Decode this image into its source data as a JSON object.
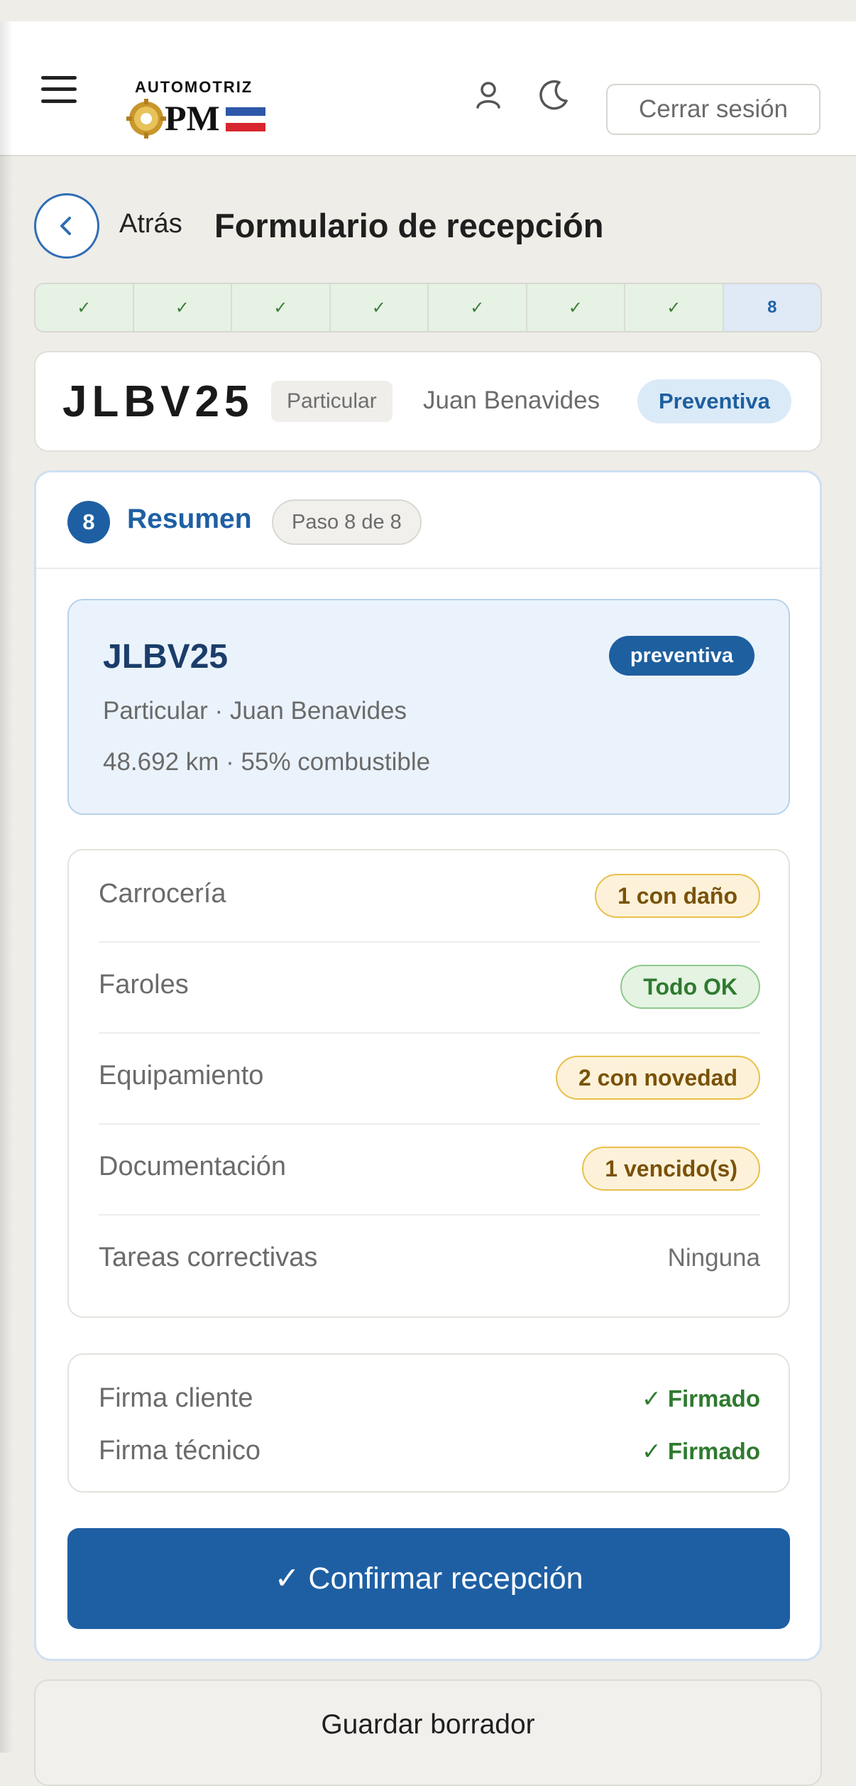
{
  "header": {
    "logo_text": "AUTOMOTRIZ",
    "logo_mark": "PM",
    "logout_label": "Cerrar sesión",
    "icons": [
      "menu-icon",
      "user-icon",
      "moon-icon"
    ]
  },
  "nav": {
    "back_label": "Atrás",
    "title": "Formulario de recepción"
  },
  "stepper": {
    "steps": [
      "✓",
      "✓",
      "✓",
      "✓",
      "✓",
      "✓",
      "✓",
      "8"
    ],
    "current": 8
  },
  "vehicle": {
    "plate": "JLBV25",
    "type": "Particular",
    "owner": "Juan Benavides",
    "service": "Preventiva"
  },
  "section": {
    "number": "8",
    "title": "Resumen",
    "step_label": "Paso 8 de 8"
  },
  "summary": {
    "plate": "JLBV25",
    "badge": "preventiva",
    "line1": "Particular · Juan Benavides",
    "line2": "48.692 km · 55% combustible"
  },
  "checks": [
    {
      "label": "Carrocería",
      "value": "1 con daño",
      "status": "warn"
    },
    {
      "label": "Faroles",
      "value": "Todo OK",
      "status": "ok"
    },
    {
      "label": "Equipamiento",
      "value": "2 con novedad",
      "status": "warn"
    },
    {
      "label": "Documentación",
      "value": "1 vencido(s)",
      "status": "warn"
    },
    {
      "label": "Tareas correctivas",
      "value": "Ninguna",
      "status": "none"
    }
  ],
  "signatures": [
    {
      "label": "Firma cliente",
      "status": "✓ Firmado"
    },
    {
      "label": "Firma técnico",
      "status": "✓ Firmado"
    }
  ],
  "actions": {
    "confirm_label": "✓ Confirmar recepción",
    "draft_label": "Guardar borrador"
  },
  "colors": {
    "primary": "#1e5fa3",
    "success": "#2f7a2f",
    "warning_border": "#e9bf4a"
  }
}
